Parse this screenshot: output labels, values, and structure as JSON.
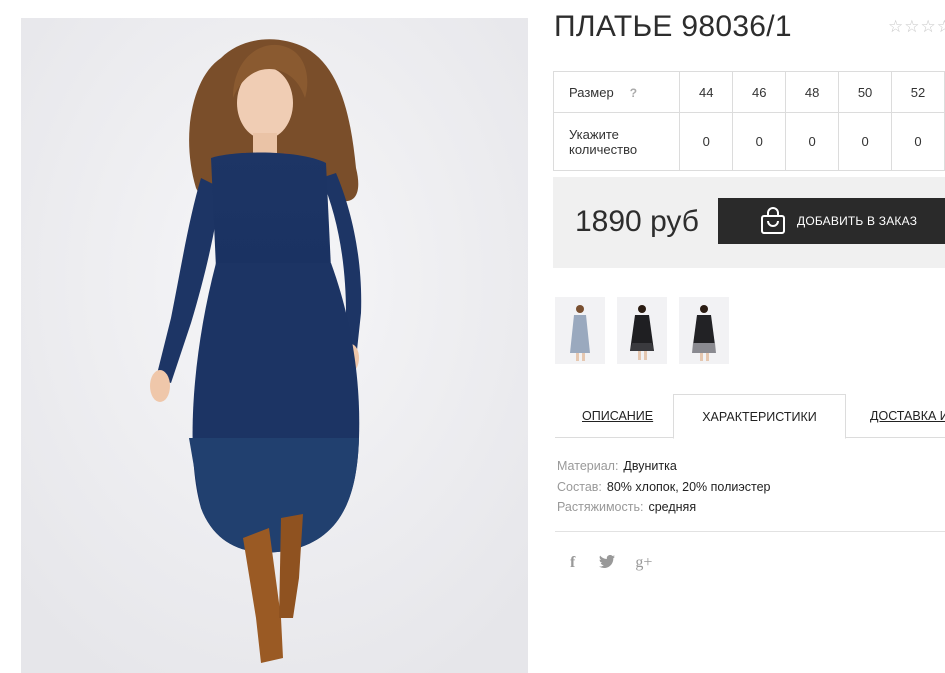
{
  "product": {
    "title": "ПЛАТЬЕ 98036/1",
    "rating_stars": 5,
    "rating_filled": 0
  },
  "size_table": {
    "size_label": "Размер",
    "help_mark": "?",
    "qty_label_line1": "Укажите",
    "qty_label_line2": "количество",
    "sizes": [
      "44",
      "46",
      "48",
      "50",
      "52"
    ],
    "quantities": [
      "0",
      "0",
      "0",
      "0",
      "0"
    ]
  },
  "purchase": {
    "price": "1890 руб",
    "add_button_label": "ДОБАВИТЬ В ЗАКАЗ",
    "button_icon": "shopping-bag-icon"
  },
  "thumbnails": [
    {
      "name": "thumbnail-grey-dress",
      "color": "#9aa9be"
    },
    {
      "name": "thumbnail-black-dress",
      "color": "#1f1f22"
    },
    {
      "name": "thumbnail-black-grey-dress",
      "color": "#222225"
    }
  ],
  "tabs": [
    {
      "label": "ОПИСАНИЕ",
      "active": false
    },
    {
      "label": "ХАРАКТЕРИСТИКИ",
      "active": true
    },
    {
      "label": "ДОСТАВКА И",
      "active": false
    }
  ],
  "specs": [
    {
      "key": "Материал:",
      "value": "Двунитка"
    },
    {
      "key": "Состав:",
      "value": "80% хлопок, 20% полиэстер"
    },
    {
      "key": "Растяжимость:",
      "value": "средняя"
    }
  ],
  "social": {
    "facebook": "f",
    "twitter": "🐦",
    "google_plus": "g+"
  },
  "colors": {
    "dress_main": "#1f3866",
    "button_bg": "#2a2a2a",
    "price_bar_bg": "#f0f0f0",
    "boots": "#9a5a24"
  }
}
